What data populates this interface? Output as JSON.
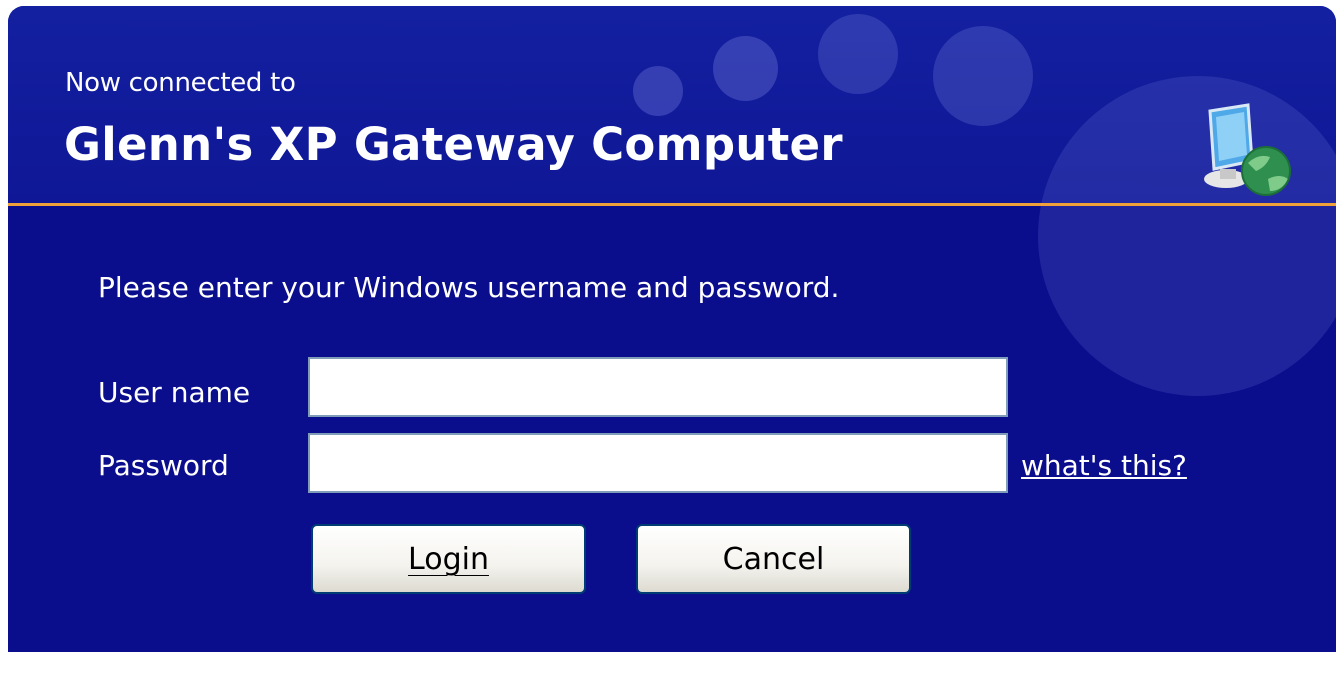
{
  "header": {
    "subtitle": "Now connected to",
    "title": "Glenn's XP Gateway Computer",
    "icon": "computer-network-icon"
  },
  "form": {
    "prompt": "Please enter your Windows username and password.",
    "username_label": "User name",
    "username_value": "",
    "password_label": "Password",
    "password_value": "",
    "help_link": "what's this?"
  },
  "buttons": {
    "login": "Login",
    "cancel": "Cancel"
  },
  "colors": {
    "background": "#0a0d8c",
    "accent_line": "#f0a13a",
    "text": "#ffffff"
  }
}
